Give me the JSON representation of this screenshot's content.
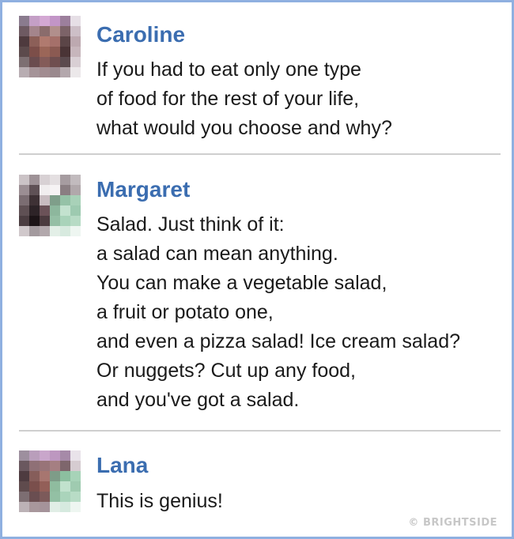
{
  "posts": [
    {
      "author": "Caroline",
      "lines": [
        "If you had to eat only one type",
        "of food for the rest of your life,",
        "what would you choose and why?"
      ]
    },
    {
      "author": "Margaret",
      "lines": [
        "Salad. Just think of it:",
        "a salad can mean anything.",
        "You can make a vegetable salad,",
        "a fruit or potato one,",
        "and even a pizza salad! Ice cream salad?",
        "Or nuggets? Cut up any food,",
        "and you've got a salad."
      ]
    },
    {
      "author": "Lana",
      "lines": [
        "This is genius!"
      ]
    }
  ],
  "watermark": "© BRIGHTSIDE",
  "colors": {
    "author_name": "#3b6db0",
    "text": "#1a1a1a",
    "divider": "#cfcfcf",
    "frame": "#8fb0e0"
  }
}
